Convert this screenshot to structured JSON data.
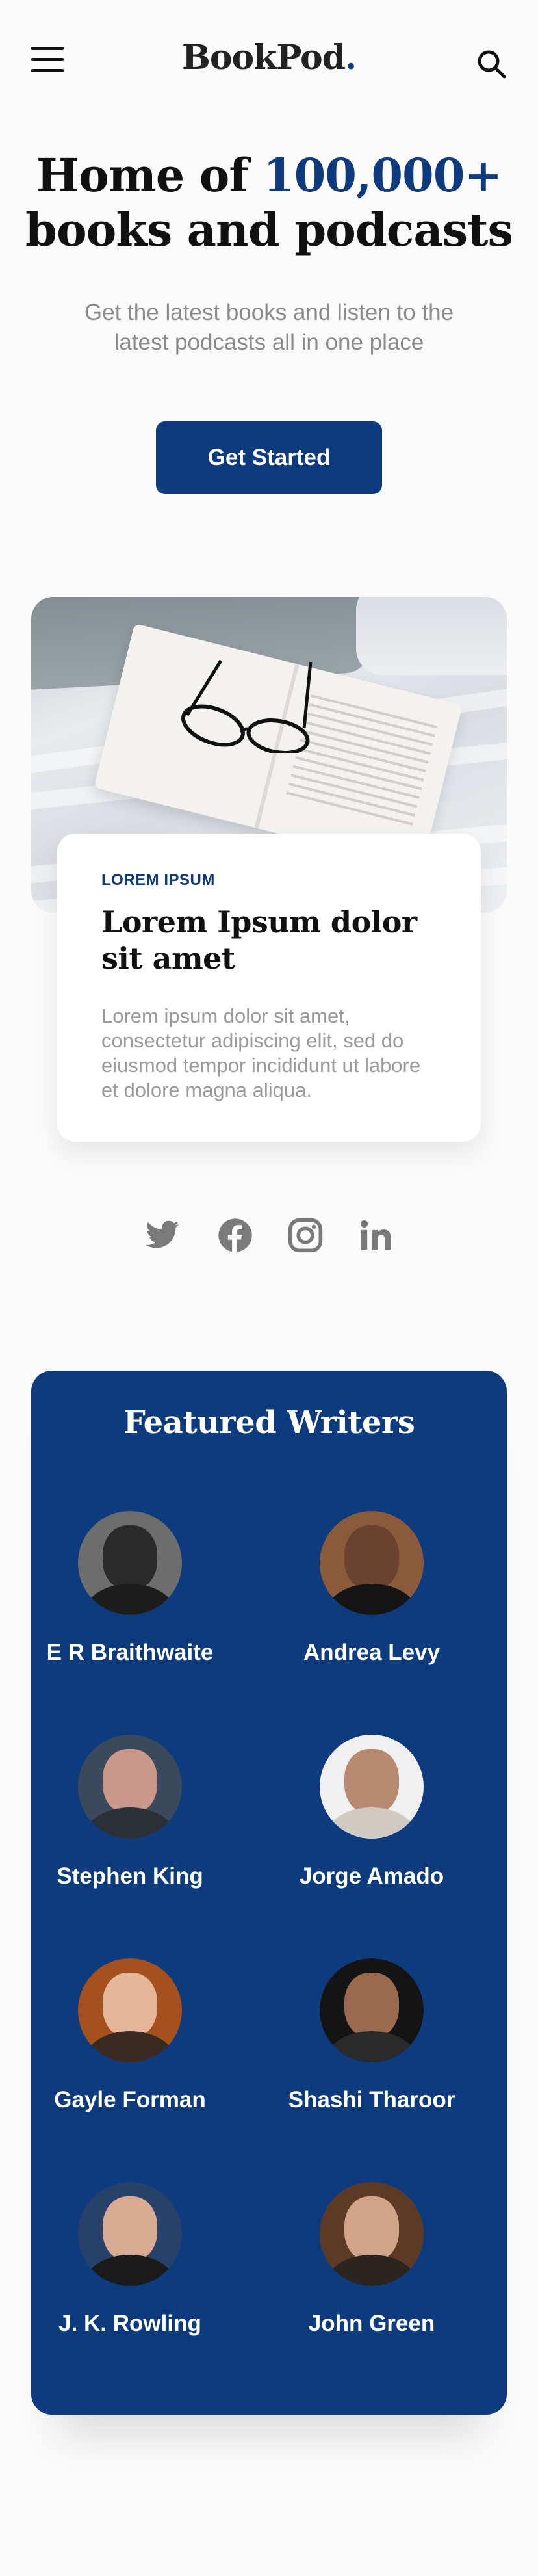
{
  "header": {
    "logo": "BookPod",
    "logo_dot": "."
  },
  "hero": {
    "title_line1_prefix": "Home of ",
    "title_accent": "100,000+",
    "title_line2": "books and podcasts",
    "subtitle": "Get the latest books and listen to the latest podcasts all in one place",
    "cta_label": "Get Started"
  },
  "card": {
    "eyebrow": "LOREM IPSUM",
    "title": "Lorem Ipsum dolor sit amet",
    "text": "Lorem ipsum dolor sit amet, consectetur adipiscing elit, sed do eiusmod tempor incididunt ut labore et dolore magna aliqua."
  },
  "social": {
    "icons": [
      "twitter-icon",
      "facebook-icon",
      "instagram-icon",
      "linkedin-icon"
    ]
  },
  "featured": {
    "title": "Featured Writers",
    "writers": [
      {
        "name": "E R Braithwaite"
      },
      {
        "name": "Andrea Levy"
      },
      {
        "name": "Stephen King"
      },
      {
        "name": "Jorge Amado"
      },
      {
        "name": "Gayle Forman"
      },
      {
        "name": "Shashi Tharoor"
      },
      {
        "name": "J. K. Rowling"
      },
      {
        "name": "John Green"
      }
    ]
  },
  "colors": {
    "brand": "#0d3b7e",
    "background": "#fafafa",
    "text": "#111111",
    "muted": "#8a8a8a",
    "icon_gray": "#7a7a7a"
  }
}
